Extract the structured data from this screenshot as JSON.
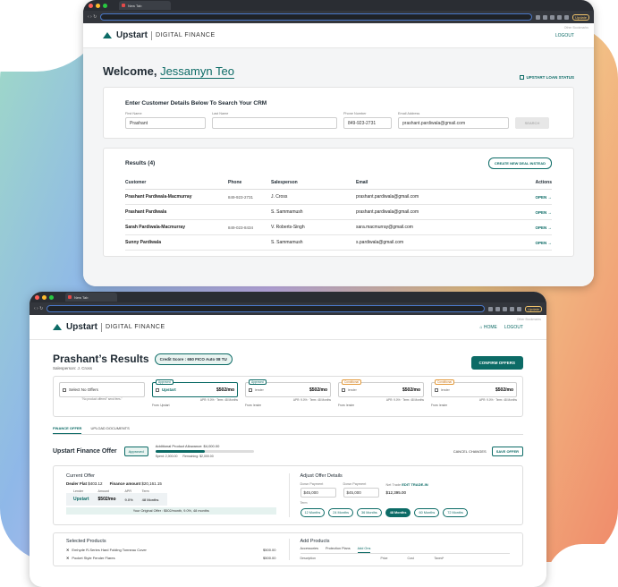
{
  "colors": {
    "accent": "#0c6b66",
    "dark": "#1f2a33"
  },
  "browser1": {
    "tab": "New Tab",
    "update": "Update",
    "bookmarks": "Other Bookmarks"
  },
  "browser2": {
    "tab": "New Tab",
    "update": "Update",
    "bookmarks": "Other Bookmarks"
  },
  "brand": {
    "name": "Upstart",
    "sub": "DIGITAL FINANCE"
  },
  "screen1": {
    "logout": "LOGOUT",
    "welcome_prefix": "Welcome,",
    "user_name": "Jessamyn Teo",
    "loan_status": "UPSTART LOAN STATUS",
    "search": {
      "title": "Enter Customer Details Below To Search Your CRM",
      "first_name_label": "First Name",
      "first_name_value": "Prashant",
      "last_name_label": "Last Name",
      "last_name_value": "",
      "phone_label": "Phone Number",
      "phone_value": "849-923-2731",
      "email_label": "Email Address",
      "email_value": "prashant.pardiwala@gmail.com",
      "search_button": "SEARCH"
    },
    "results": {
      "title": "Results (4)",
      "new_deal_button": "CREATE NEW DEAL INSTEAD",
      "columns": [
        "Customer",
        "Phone",
        "Salesperson",
        "Email",
        "Actions"
      ],
      "rows": [
        {
          "customer": "Prashant Pardiwala-Macmurray",
          "phone": "849-923-2731",
          "salesperson": "J. Cross",
          "email": "prashant.pardiwala@gmail.com",
          "action": "OPEN →"
        },
        {
          "customer": "Prashant Pardiwala",
          "phone": "",
          "salesperson": "S. Sammamush",
          "email": "prashant.pardiwala@gmail.com",
          "action": "OPEN →"
        },
        {
          "customer": "Sarah Pardiwala-Macmurray",
          "phone": "849-023-8434",
          "salesperson": "V. Roberts-Singh",
          "email": "sara.macmurray@gmail.com",
          "action": "OPEN →"
        },
        {
          "customer": "Sunny Pardiwala",
          "phone": "",
          "salesperson": "S. Sammamush",
          "email": "s.pardiwala@gmail.com",
          "action": "OPEN →"
        }
      ]
    }
  },
  "screen2": {
    "home": "HOME",
    "logout": "LOGOUT",
    "title": "Prashant’s Results",
    "credit_score": "Credit Score : 650 FICO Auto 08 TU",
    "salesperson": "Salesperson: J. Cross",
    "confirm_button": "CONFIRM OFFERS",
    "offers": {
      "no_offers_label": "Select No Offers",
      "no_offers_sub": "\"No product offered\" send fees.\"",
      "items": [
        {
          "tag": "Approved",
          "lender": "Upstart",
          "amount": "$502/mo",
          "sub": "APR: 9.0% · Term: 48 Months",
          "from": "From: Upstart",
          "selected": true
        },
        {
          "tag": "Approved",
          "lender": "lender",
          "amount": "$502/mo",
          "sub": "APR: 9.0% · Term: 48 Months",
          "from": "From: lender",
          "selected": false
        },
        {
          "tag": "Conditional",
          "lender": "lender",
          "amount": "$502/mo",
          "sub": "APR: 9.0% · Term: 48 Months",
          "from": "From: lender",
          "selected": false
        },
        {
          "tag": "Conditional",
          "lender": "lender",
          "amount": "$502/mo",
          "sub": "APR: 9.0% · Term: 48 Months",
          "from": "From: lender",
          "selected": false
        }
      ]
    },
    "tabs": [
      "FINANCE OFFER",
      "UPLOAD DOCUMENTS"
    ],
    "finance_offer": {
      "title": "Upstart Finance Offer",
      "status": "Approved",
      "allowance_label": "Additional Product Allowance: $4,000.00",
      "allowance_used_fraction": 0.5,
      "spent": "Spent: 2,000.00",
      "remaining": "Remaining: $2,000.00",
      "cancel": "CANCEL CHANGES",
      "save": "SAVE OFFER"
    },
    "current_offer": {
      "title": "Current Offer",
      "dealer_flat_label": "Dealer Flat",
      "dealer_flat_value": "$403.12",
      "finance_amount_label": "Finance amount",
      "finance_amount_value": "$20,161.15",
      "columns": [
        "Lender",
        "Amount",
        "APR",
        "Term"
      ],
      "row": {
        "lender": "Upstart",
        "amount": "$502/mo",
        "apr": "9.0%",
        "term": "48 Months"
      },
      "original": "Your Original Offer : $502/month, 9.0%, 48 months"
    },
    "adjust": {
      "title": "Adjust Offer Details",
      "down_label": "Down Payment",
      "down_value": "$45,000",
      "down2_label": "Down Payment",
      "down2_value": "$45,000",
      "net_trade_label": "Net Trade",
      "edit_trade": "EDIT TRADE-IN",
      "net_trade_value": "$12,395.00",
      "term_label": "Term",
      "terms": [
        "12 Months",
        "24 Months",
        "36 Months",
        "48 Months",
        "60 Months",
        "72 Months"
      ],
      "selected_term": "48 Months"
    },
    "selected_products": {
      "title": "Selected Products",
      "items": [
        {
          "name": "Emhyde R-Series Hard Folding Tonneau Cover",
          "price": "$500.00"
        },
        {
          "name": "Pocket Style Fender Flares",
          "price": "$500.00"
        }
      ]
    },
    "add_products": {
      "title": "Add Products",
      "tabs": [
        "Accessories",
        "Protection Plans",
        "Add Ons"
      ],
      "active_tab": "Add Ons",
      "columns": [
        "Description",
        "Price",
        "Cost",
        "Taxed*"
      ]
    }
  }
}
